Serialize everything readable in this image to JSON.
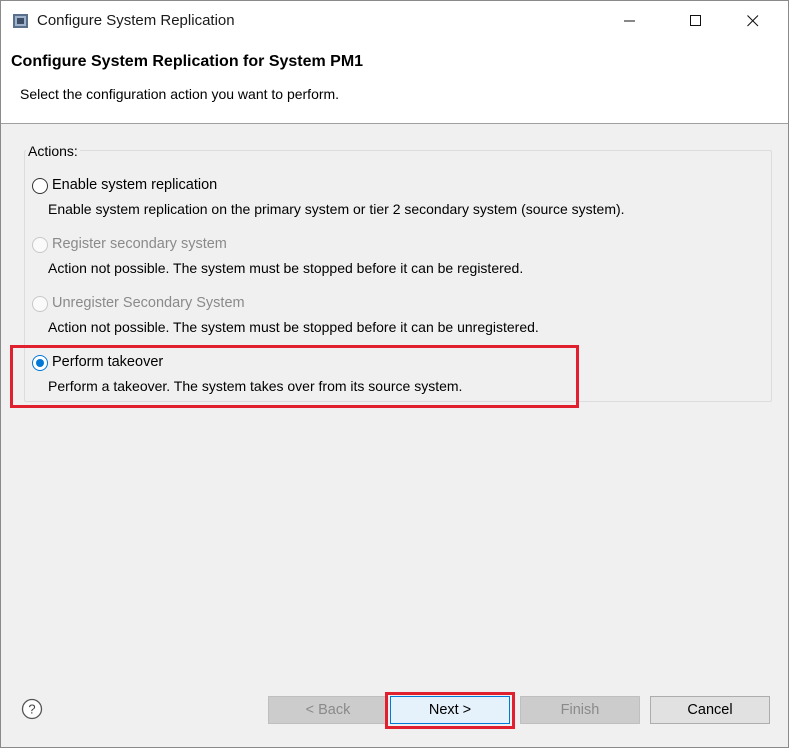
{
  "window": {
    "title": "Configure System Replication",
    "controls": [
      "minimize",
      "maximize",
      "close"
    ]
  },
  "header": {
    "title": "Configure System Replication for System PM1",
    "description": "Select the configuration action you want to perform."
  },
  "actions": {
    "label": "Actions:",
    "options": [
      {
        "label": "Enable system replication",
        "description": "Enable system replication on the primary system or tier 2 secondary system (source system).",
        "enabled": true,
        "selected": false
      },
      {
        "label": "Register secondary system",
        "description": "Action not possible. The system must be stopped before it can be registered.",
        "enabled": false,
        "selected": false
      },
      {
        "label": "Unregister Secondary System",
        "description": "Action not possible. The system must be stopped before it can be unregistered.",
        "enabled": false,
        "selected": false
      },
      {
        "label": "Perform takeover",
        "description": "Perform a takeover. The system takes over from its source system.",
        "enabled": true,
        "selected": true
      }
    ]
  },
  "footer": {
    "help_icon": "question-circle-icon",
    "back_label": "< Back",
    "next_label": "Next >",
    "finish_label": "Finish",
    "cancel_label": "Cancel"
  },
  "colors": {
    "accent": "#0078d7",
    "highlight": "#e0202e"
  }
}
